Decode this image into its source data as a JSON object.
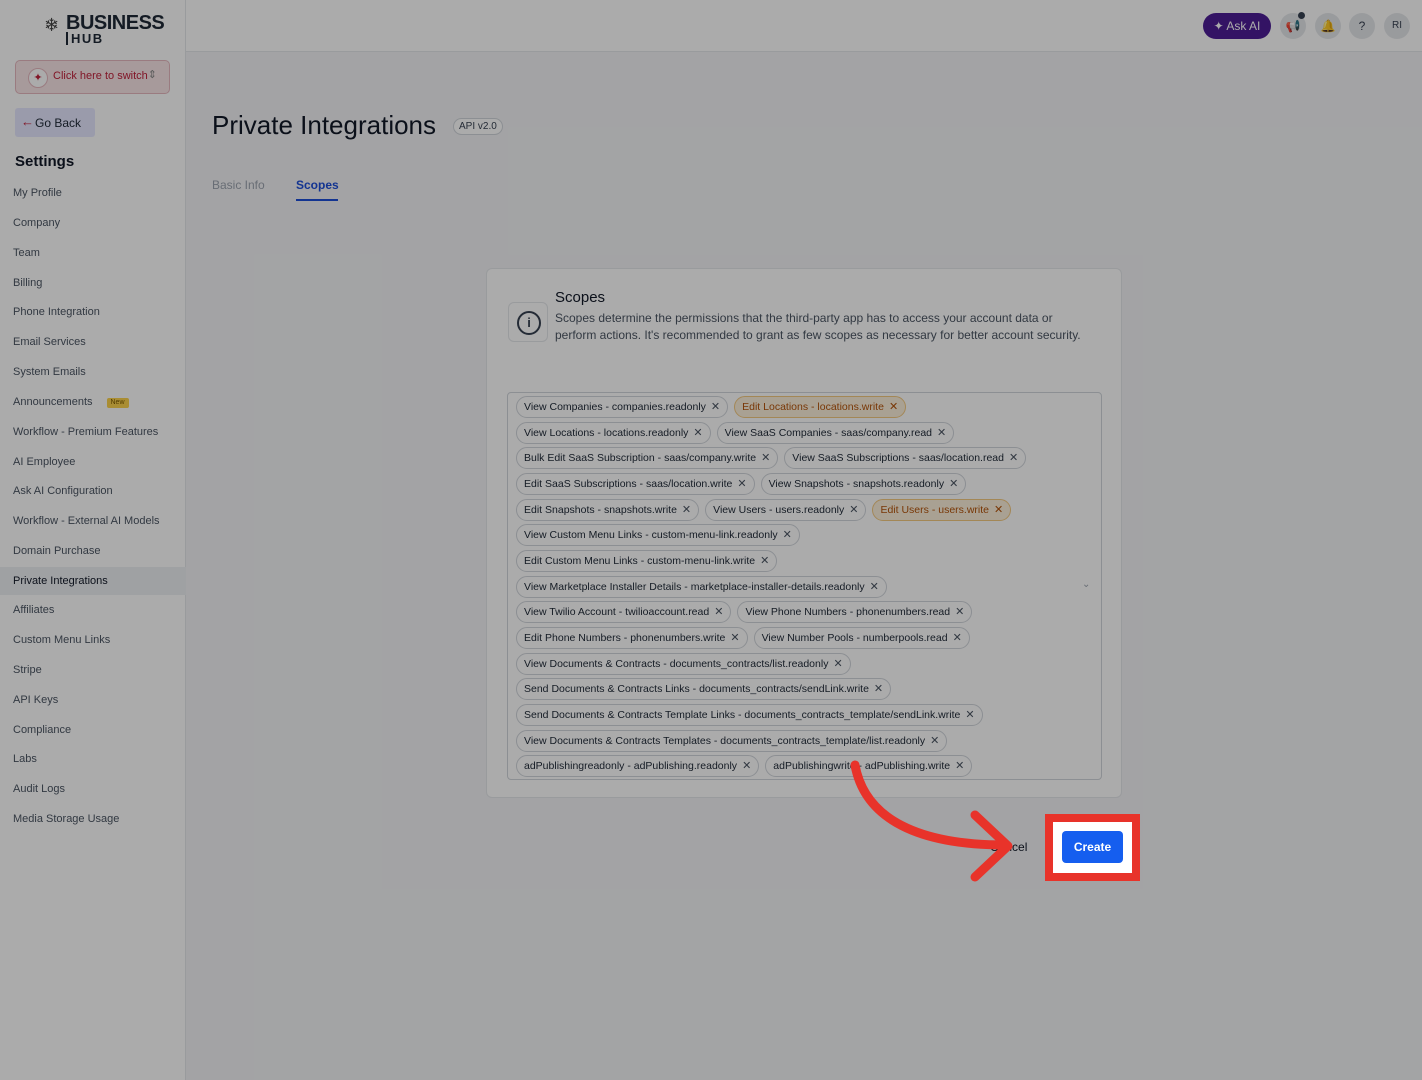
{
  "brand": {
    "line1": "BUSINESS",
    "line2": "HUB"
  },
  "switcher": {
    "label": "Click here to switch"
  },
  "go_back": {
    "label": "Go Back"
  },
  "sidebar": {
    "title": "Settings",
    "new_badge": "New",
    "items": [
      {
        "label": "My Profile"
      },
      {
        "label": "Company"
      },
      {
        "label": "Team"
      },
      {
        "label": "Billing"
      },
      {
        "label": "Phone Integration"
      },
      {
        "label": "Email Services"
      },
      {
        "label": "System Emails"
      },
      {
        "label": "Announcements"
      },
      {
        "label": "Workflow - Premium Features"
      },
      {
        "label": "AI Employee"
      },
      {
        "label": "Ask AI Configuration"
      },
      {
        "label": "Workflow - External AI Models"
      },
      {
        "label": "Domain Purchase"
      },
      {
        "label": "Private Integrations"
      },
      {
        "label": "Affiliates"
      },
      {
        "label": "Custom Menu Links"
      },
      {
        "label": "Stripe"
      },
      {
        "label": "API Keys"
      },
      {
        "label": "Compliance"
      },
      {
        "label": "Labs"
      },
      {
        "label": "Audit Logs"
      },
      {
        "label": "Media Storage Usage"
      }
    ]
  },
  "topbar": {
    "ask_ai": "Ask AI",
    "help": "?",
    "avatar": "RI"
  },
  "page": {
    "title": "Private Integrations",
    "api_badge": "API v2.0",
    "tabs": {
      "basic_info": "Basic Info",
      "scopes": "Scopes"
    }
  },
  "scopes_card": {
    "title": "Scopes",
    "description": "Scopes determine the permissions that the third-party app has to access your account data or perform actions. It's recommended to grant as few scopes as necessary for better account security.",
    "rows": [
      [
        "View Companies - companies.readonly",
        "Edit Locations - locations.write"
      ],
      [
        "View Locations - locations.readonly",
        "View SaaS Companies - saas/company.read"
      ],
      [
        "Bulk Edit SaaS Subscription - saas/company.write",
        "View SaaS Subscriptions - saas/location.read"
      ],
      [
        "Edit SaaS Subscriptions - saas/location.write",
        "View Snapshots - snapshots.readonly"
      ],
      [
        "Edit Snapshots - snapshots.write",
        "View Users - users.readonly",
        "Edit Users - users.write"
      ],
      [
        "View Custom Menu Links - custom-menu-link.readonly"
      ],
      [
        "Edit Custom Menu Links - custom-menu-link.write"
      ],
      [
        "View Marketplace Installer Details - marketplace-installer-details.readonly"
      ],
      [
        "View Twilio Account - twilioaccount.read",
        "View Phone Numbers - phonenumbers.read"
      ],
      [
        "Edit Phone Numbers - phonenumbers.write",
        "View Number Pools - numberpools.read"
      ],
      [
        "View Documents & Contracts - documents_contracts/list.readonly"
      ],
      [
        "Send Documents & Contracts Links - documents_contracts/sendLink.write"
      ],
      [
        "Send Documents & Contracts Template Links - documents_contracts_template/sendLink.write"
      ],
      [
        "View Documents & Contracts Templates - documents_contracts_template/list.readonly"
      ],
      [
        "adPublishingreadonly - adPublishing.readonly",
        "adPublishingwrite - adPublishing.write"
      ]
    ],
    "warning_chips": [
      "Edit Locations - locations.write",
      "Edit Users - users.write"
    ]
  },
  "actions": {
    "cancel": "Cancel",
    "create": "Create"
  },
  "colors": {
    "highlight": "#e8332a",
    "primary": "#155eef",
    "ask_ai": "#4c1d95"
  }
}
